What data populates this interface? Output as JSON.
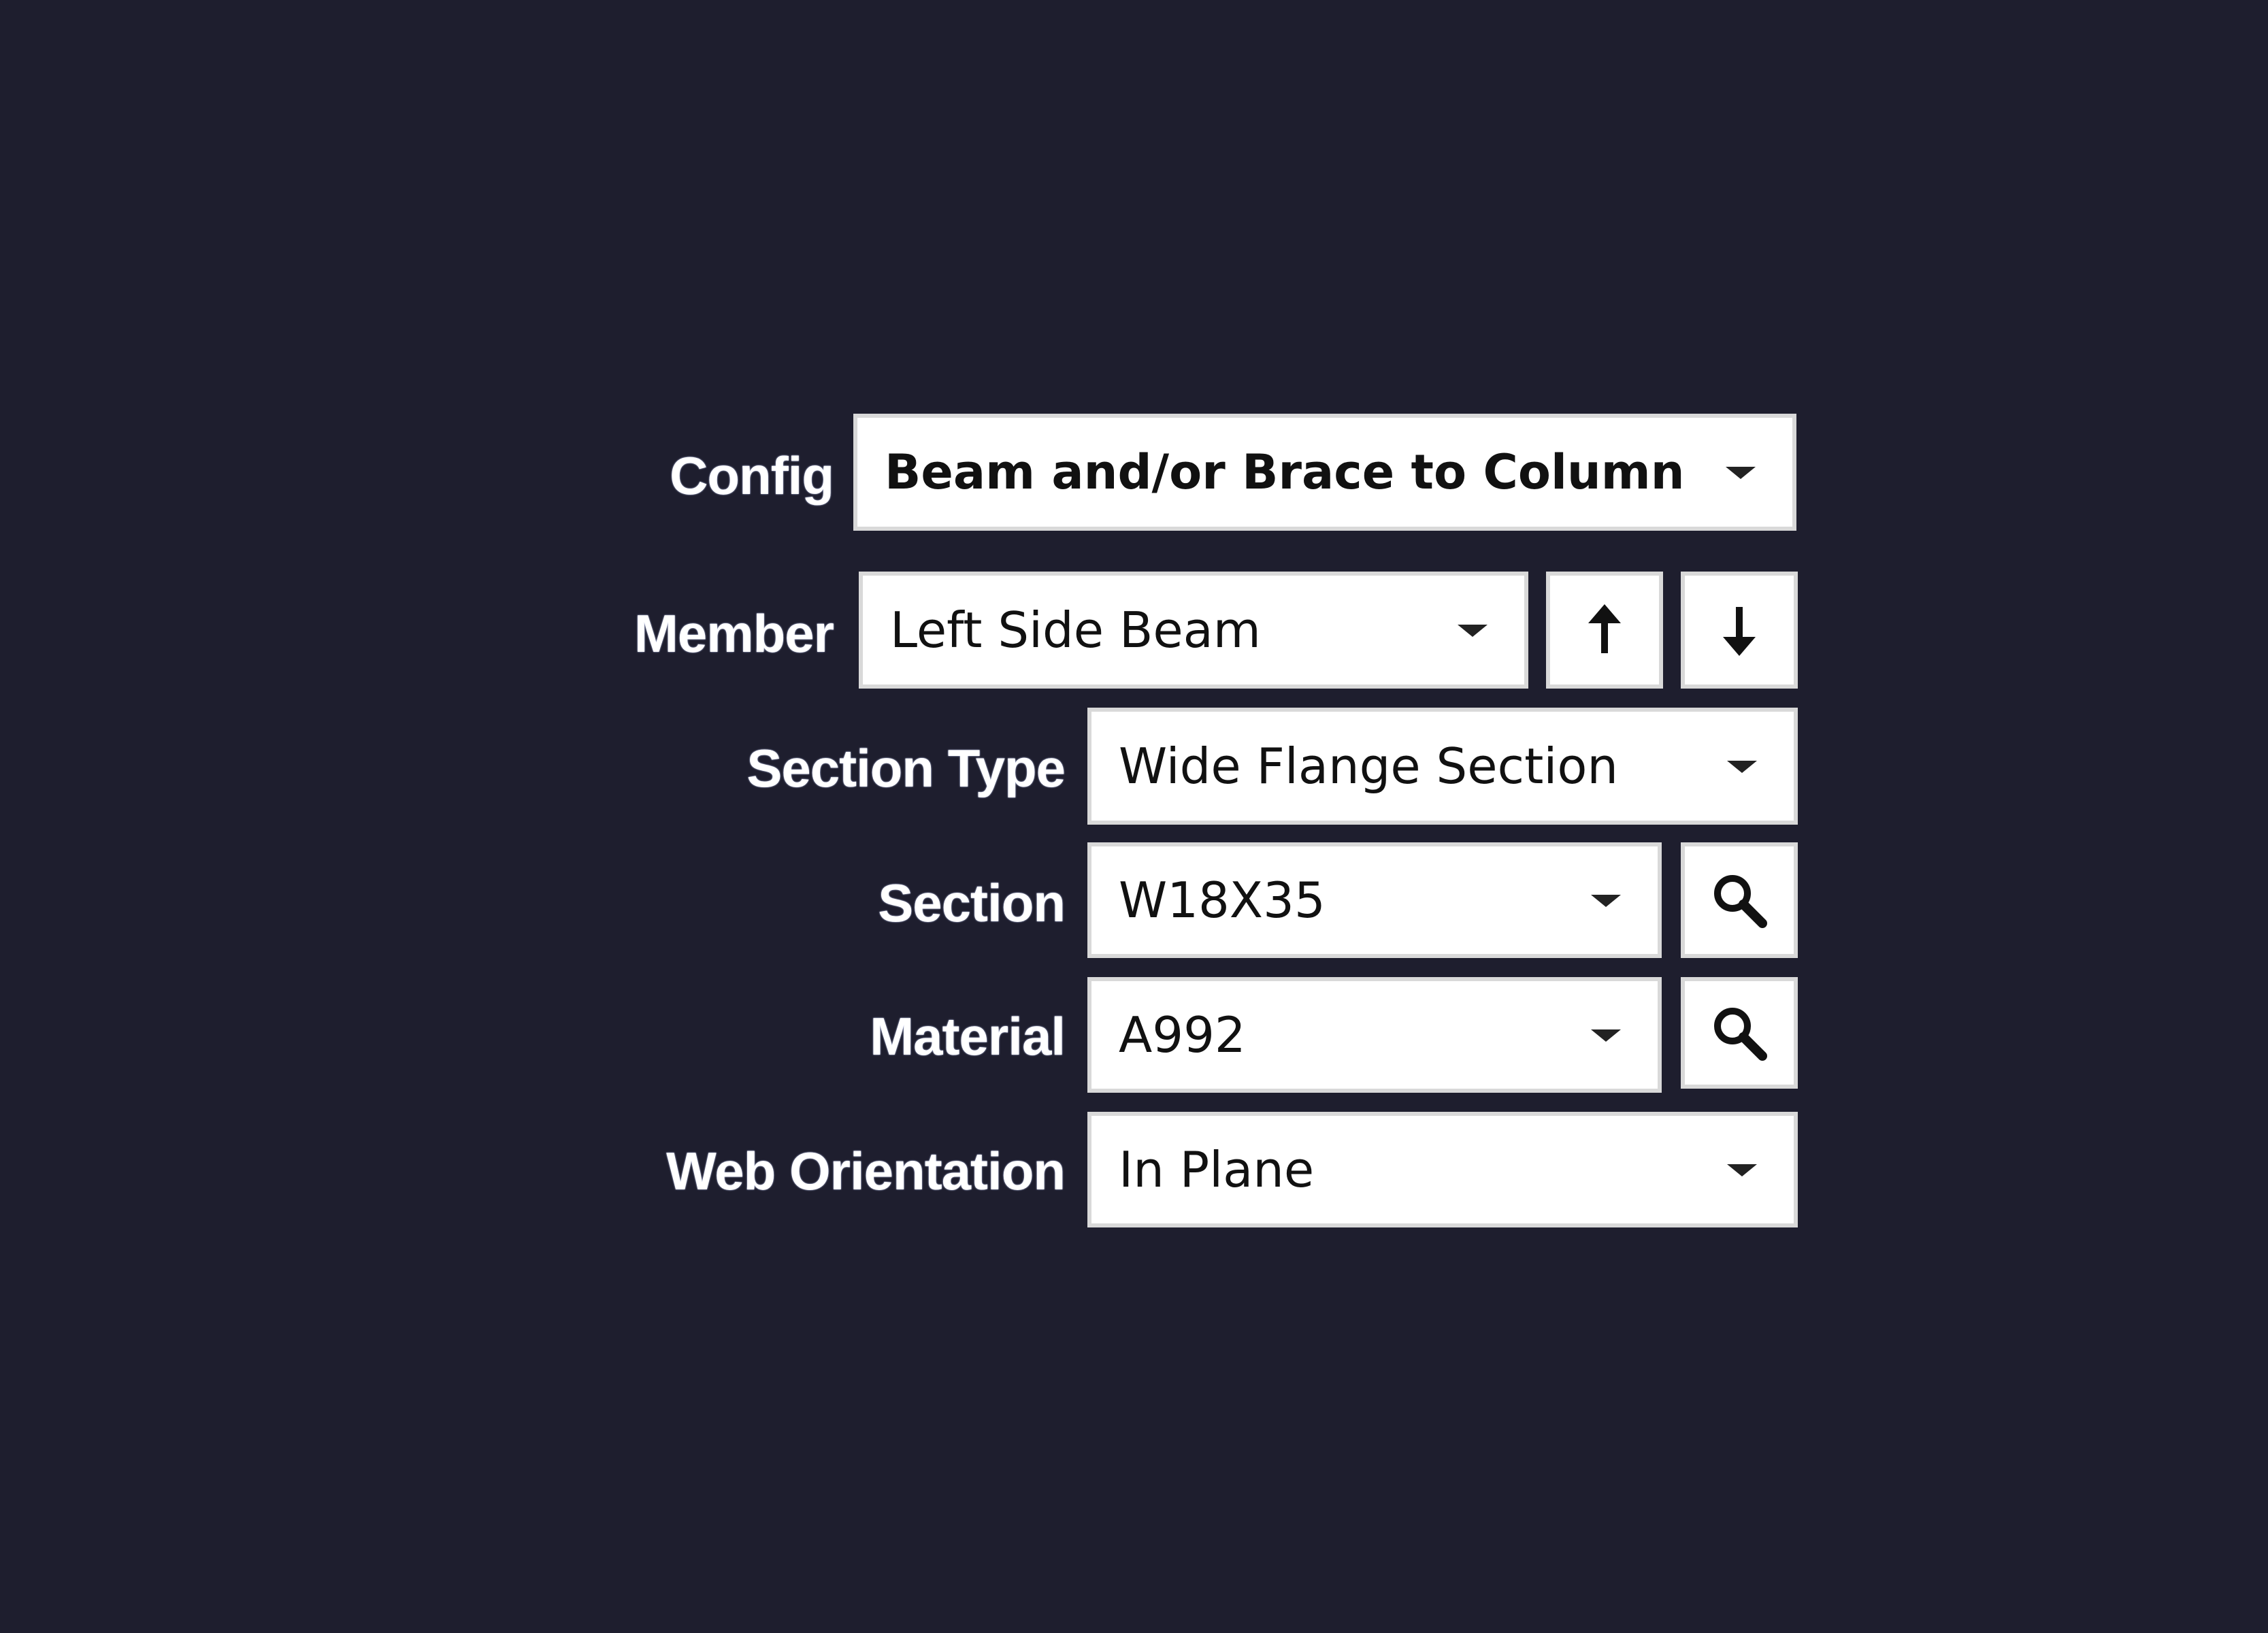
{
  "form": {
    "config": {
      "label": "Config",
      "value": "Beam and/or Brace to Column"
    },
    "member": {
      "label": "Member",
      "value": "Left Side Beam",
      "up_icon": "arrow-up-icon",
      "down_icon": "arrow-down-icon"
    },
    "section_type": {
      "label": "Section Type",
      "value": "Wide Flange Section"
    },
    "section": {
      "label": "Section",
      "value": "W18X35",
      "search_icon": "search-icon"
    },
    "material": {
      "label": "Material",
      "value": "A992",
      "search_icon": "search-icon"
    },
    "web_orientation": {
      "label": "Web Orientation",
      "value": "In Plane"
    }
  },
  "colors": {
    "background": "#1e1e2e",
    "label_text": "#ffffff",
    "field_background": "#ffffff",
    "field_border": "#d9d9d9",
    "field_text": "#111111"
  }
}
